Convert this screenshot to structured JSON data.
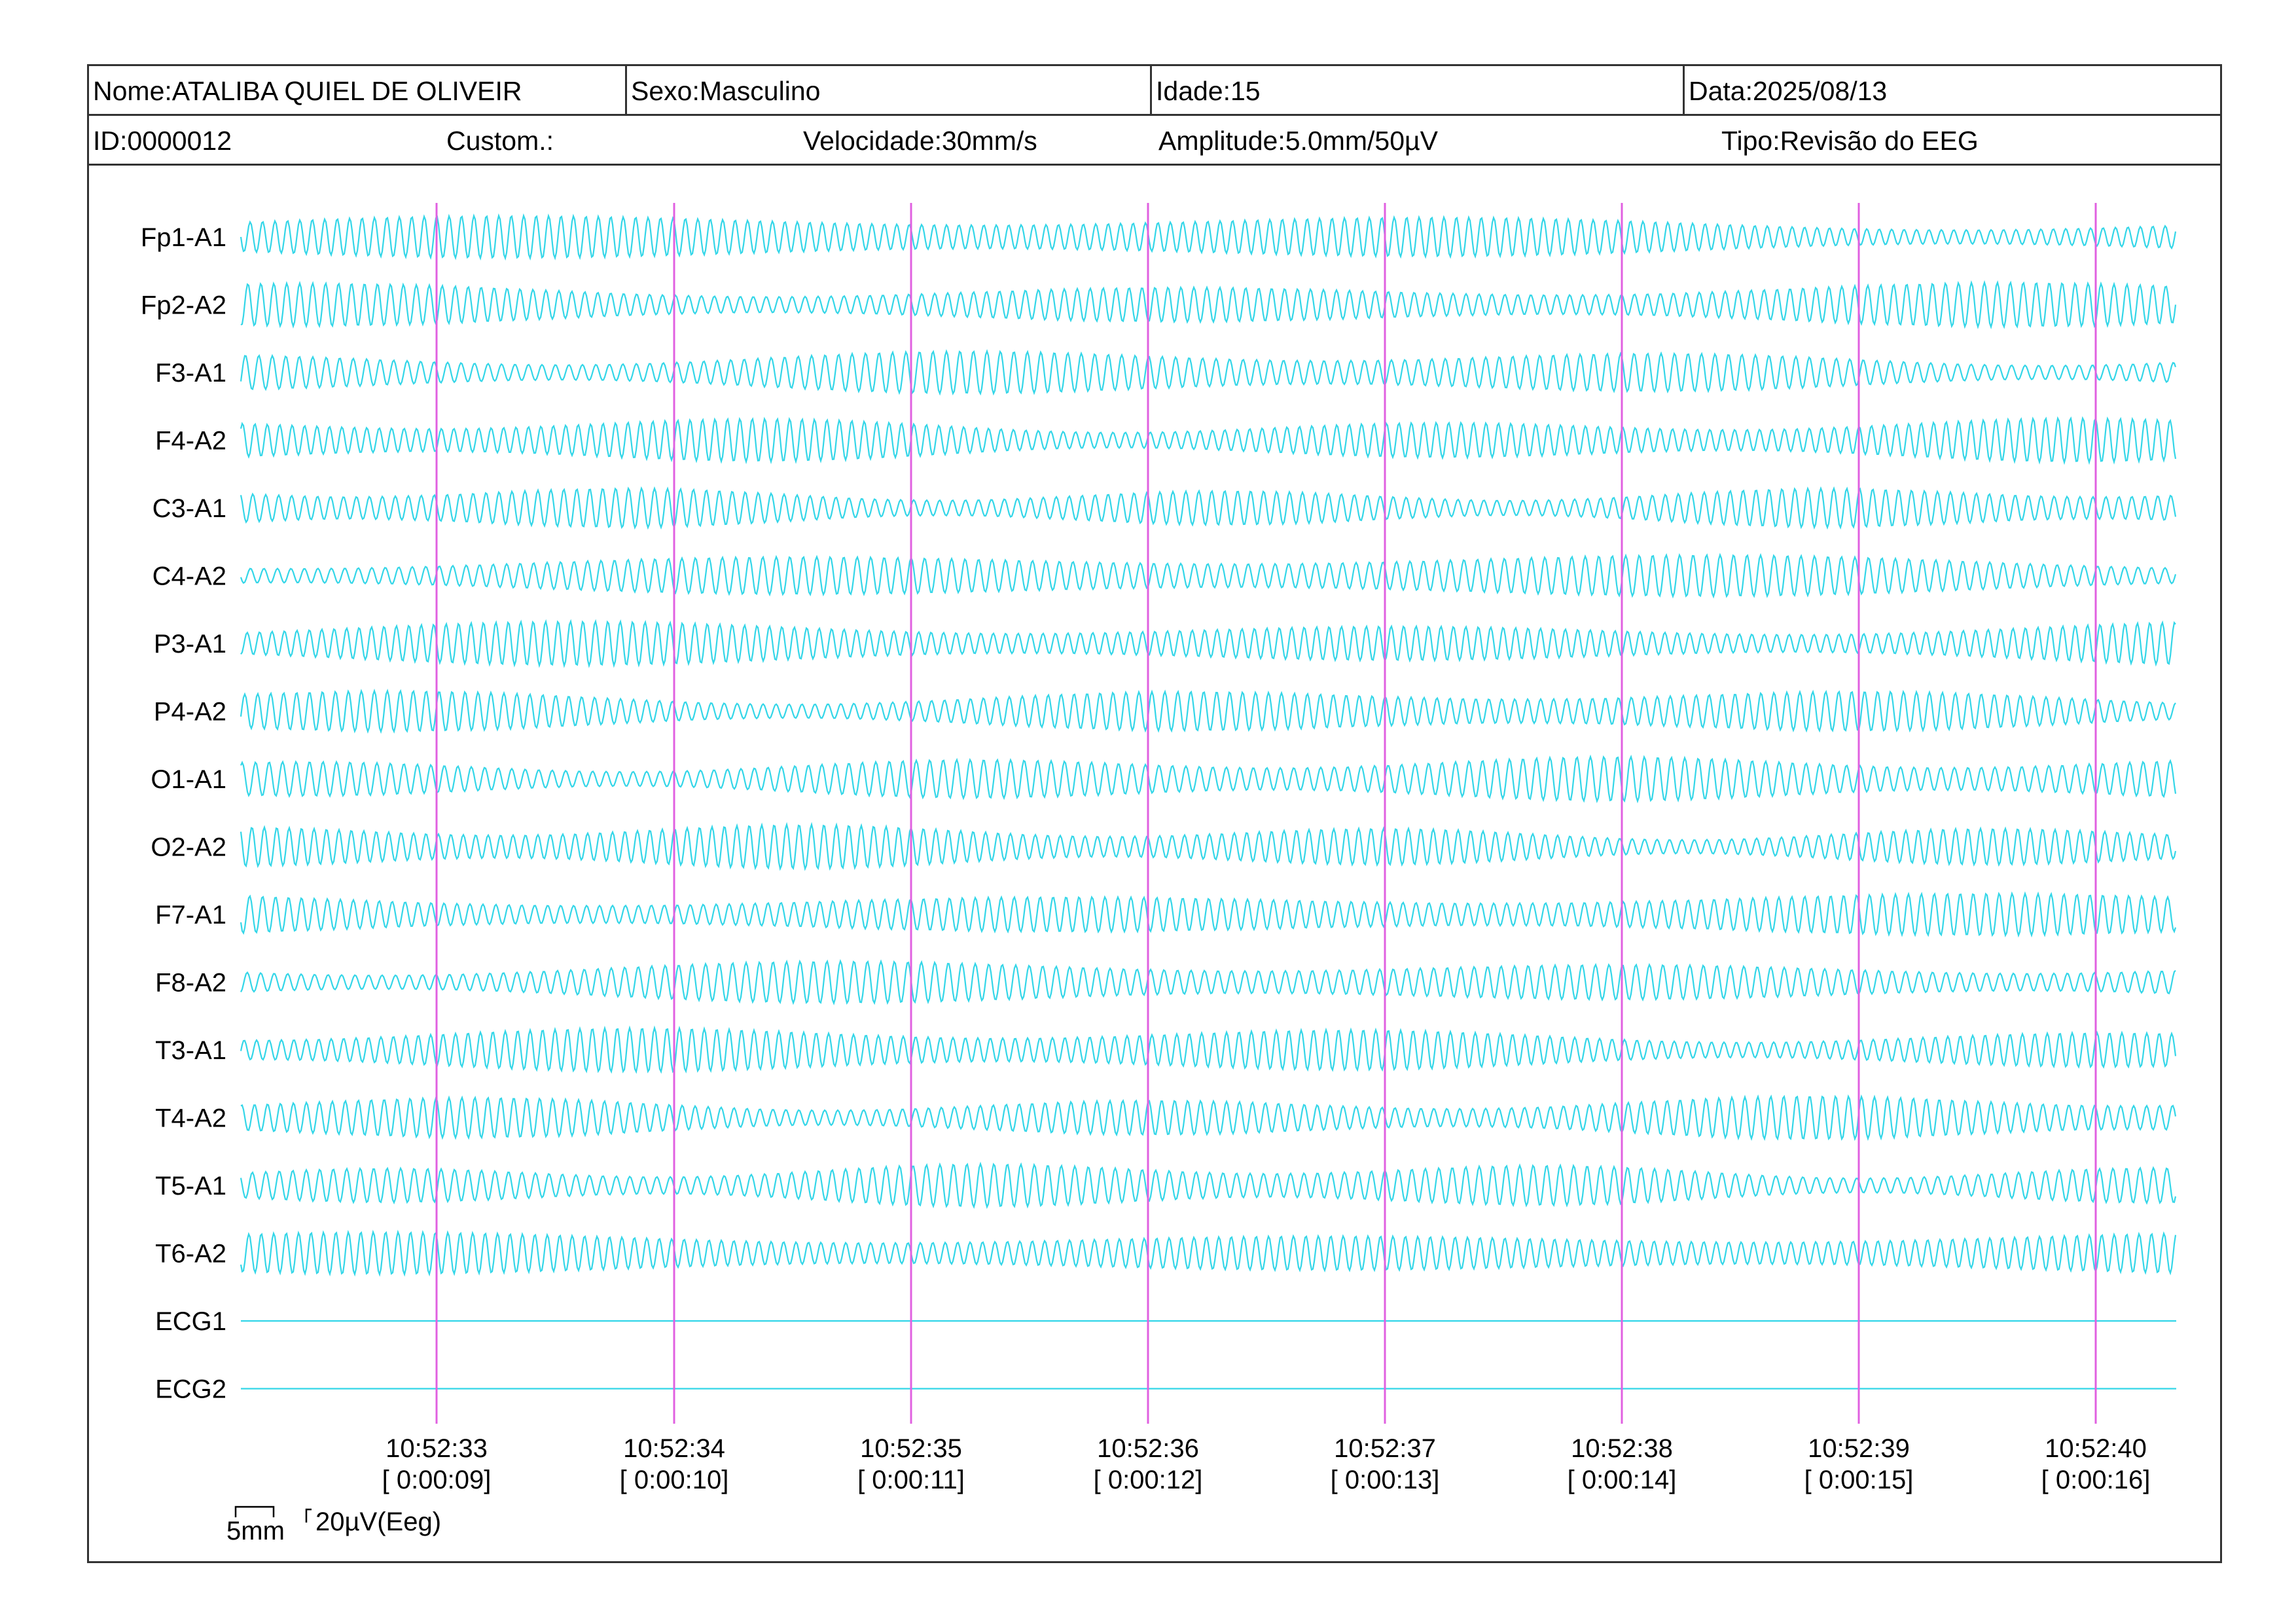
{
  "header": {
    "row1": [
      {
        "text": "Nome:ATALIBA QUIEL DE OLIVEIR"
      },
      {
        "text": "Sexo:Masculino"
      },
      {
        "text": "Idade:15"
      },
      {
        "text": "Data:2025/08/13"
      }
    ],
    "row2": [
      {
        "text": "ID:0000012"
      },
      {
        "text": "Custom.:"
      },
      {
        "text": "Velocidade:30mm/s"
      },
      {
        "text": "Amplitude:5.0mm/50µV"
      },
      {
        "text": "Tipo:Revisão do EEG"
      }
    ]
  },
  "chart_data": {
    "type": "line",
    "channels": [
      "Fp1-A1",
      "Fp2-A2",
      "F3-A1",
      "F4-A2",
      "C3-A1",
      "C4-A2",
      "P3-A1",
      "P4-A2",
      "O1-A1",
      "O2-A2",
      "F7-A1",
      "F8-A2",
      "T3-A1",
      "T4-A2",
      "T5-A1",
      "T6-A2",
      "ECG1",
      "ECG2"
    ],
    "time_labels": [
      {
        "clock": "10:52:33",
        "elapsed": "[ 0:00:09]"
      },
      {
        "clock": "10:52:34",
        "elapsed": "[ 0:00:10]"
      },
      {
        "clock": "10:52:35",
        "elapsed": "[ 0:00:11]"
      },
      {
        "clock": "10:52:36",
        "elapsed": "[ 0:00:12]"
      },
      {
        "clock": "10:52:37",
        "elapsed": "[ 0:00:13]"
      },
      {
        "clock": "10:52:38",
        "elapsed": "[ 0:00:14]"
      },
      {
        "clock": "10:52:39",
        "elapsed": "[ 0:00:15]"
      },
      {
        "clock": "10:52:40",
        "elapsed": "[ 0:00:16]"
      }
    ],
    "scale_bar": {
      "time": "5mm",
      "amplitude": "20µV(Eeg)"
    },
    "trace_color": "#33d6e8",
    "marker_color": "#e060e0"
  }
}
